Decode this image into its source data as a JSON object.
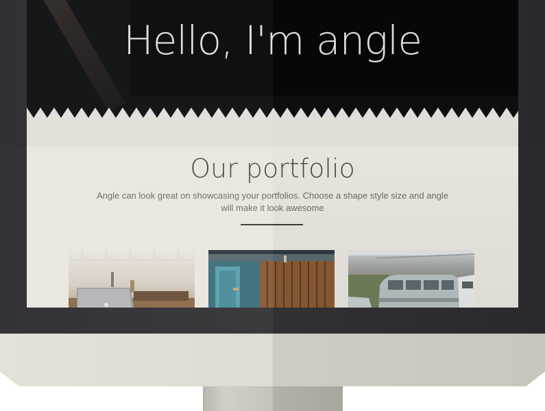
{
  "hero": {
    "title": "Hello, I'm angle"
  },
  "portfolio": {
    "title": "Our portfolio",
    "description": "Angle can look great on showcasing your portfolios. Choose a shape style size and angle will make it look awesome"
  },
  "thumbnails": [
    {
      "subject": "laptop on desk against white tile wall"
    },
    {
      "subject": "weathered blue and wooden shed doors"
    },
    {
      "subject": "vintage vans parked on a street"
    }
  ],
  "colors": {
    "hero_bg": "#0e0f11",
    "page_bg": "#e9e7df",
    "bezel": "#2f2d31",
    "title_text": "#e8e6e0"
  }
}
